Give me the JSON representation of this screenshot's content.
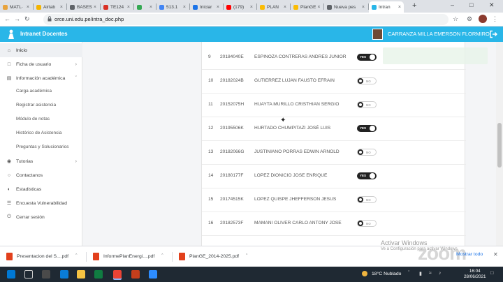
{
  "browser": {
    "tabs": [
      {
        "label": "MATL·",
        "color": "#e8a33d"
      },
      {
        "label": "Airtab",
        "color": "#f4b400"
      },
      {
        "label": "BASES",
        "color": "#5f6368"
      },
      {
        "label": "TE124",
        "color": "#d93025"
      },
      {
        "label": "",
        "color": "#34a853"
      },
      {
        "label": "513.1",
        "color": "#4285f4"
      },
      {
        "label": "Iniciar",
        "color": "#1a73e8"
      },
      {
        "label": "(179)",
        "color": "#ff0000"
      },
      {
        "label": "PLAN",
        "color": "#fbbc04"
      },
      {
        "label": "PlanGE",
        "color": "#fbbc04"
      },
      {
        "label": "Nueva pes",
        "color": "#5f6368"
      },
      {
        "label": "Intran",
        "color": "#29b6e8"
      }
    ],
    "url": "orce.uni.edu.pe/intra_doc.php"
  },
  "app": {
    "title": "Intranet Docentes",
    "user_name": "CARRANZA MILLA EMERSON FLORMIRO"
  },
  "sidebar": {
    "items": [
      {
        "label": "Inicio",
        "icon": "home-icon"
      },
      {
        "label": "Ficha de usuario",
        "icon": "file-icon"
      },
      {
        "label": "Información académica",
        "icon": "book-icon"
      }
    ],
    "subitems": [
      "Carga académica",
      "Registrar asistencia",
      "Módulo de notas",
      "Histórico de Asistencia",
      "Preguntas y Solucionarios"
    ],
    "items2": [
      {
        "label": "Tutorias",
        "icon": "tutor-icon"
      },
      {
        "label": "Contactanos",
        "icon": "chat-icon"
      },
      {
        "label": "Estadisticas",
        "icon": "stats-icon"
      },
      {
        "label": "Encuesta Vulnerabilidad",
        "icon": "survey-icon"
      },
      {
        "label": "Cerrar sesión",
        "icon": "power-icon"
      }
    ]
  },
  "attendance": {
    "yes_label": "YES",
    "no_label": "NO",
    "rows": [
      {
        "n": "9",
        "code": "20184040E",
        "name": "ESPINOZA CONTRERAS ANDRES JUNIOR",
        "present": true
      },
      {
        "n": "10",
        "code": "20182024B",
        "name": "GUTIERREZ LUJAN FAUSTO EFRAIN",
        "present": false
      },
      {
        "n": "11",
        "code": "20152075H",
        "name": "HUAYTA MURILLO CRISTHIAN SERGIO",
        "present": false
      },
      {
        "n": "12",
        "code": "20195506K",
        "name": "HURTADO CHUMPITAZI JOSÉ LUIS",
        "present": true
      },
      {
        "n": "13",
        "code": "20182066G",
        "name": "JUSTINIANO PORRAS EDWIN ARNOLD",
        "present": false
      },
      {
        "n": "14",
        "code": "20180177F",
        "name": "LOPEZ DIONICIO JOSE ENRIQUE",
        "present": true
      },
      {
        "n": "15",
        "code": "20174515K",
        "name": "LOPEZ QUISPE JHEFFERSON JESUS",
        "present": false
      },
      {
        "n": "16",
        "code": "20182573F",
        "name": "MAMANI OLIVER CARLO ANTONY JOSE",
        "present": false
      }
    ]
  },
  "downloads": {
    "files": [
      "Presentacion del S....pdf",
      "InformePlanEnergi....pdf",
      "PlanGE_2014-2025.pdf"
    ],
    "show_all": "Mostrar todo"
  },
  "watermark": {
    "activate_title": "Activar Windows",
    "activate_sub": "Ve a Configuración para activar Windows.",
    "zoom": "zoom"
  },
  "taskbar": {
    "weather": "18°C  Nublado",
    "time": "16:04",
    "date": "28/06/2021"
  }
}
